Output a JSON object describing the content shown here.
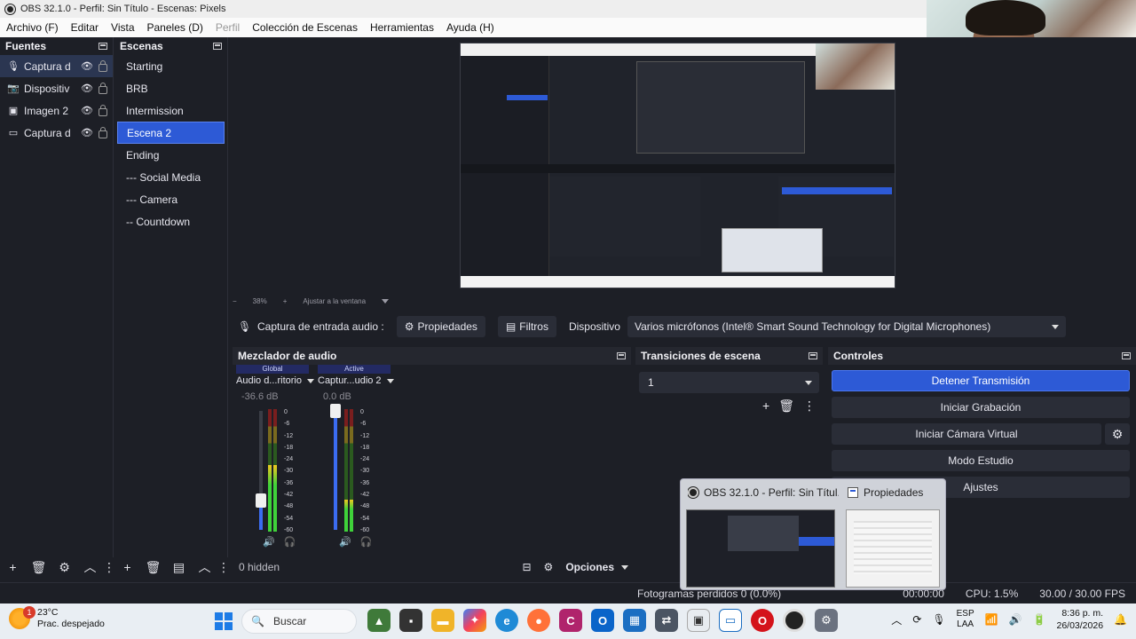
{
  "window": {
    "title": "OBS 32.1.0 - Perfil: Sin Título - Escenas: Pixels"
  },
  "menu": [
    "Archivo (F)",
    "Editar",
    "Vista",
    "Paneles (D)",
    "Perfil",
    "Colección de Escenas",
    "Herramientas",
    "Ayuda (H)"
  ],
  "sources": {
    "title": "Fuentes",
    "items": [
      {
        "name": "Captura d",
        "icon": "microphone-icon"
      },
      {
        "name": "Dispositiv",
        "icon": "camera-icon"
      },
      {
        "name": "Imagen 2",
        "icon": "image-icon"
      },
      {
        "name": "Captura d",
        "icon": "monitor-icon"
      }
    ]
  },
  "scenes": {
    "title": "Escenas",
    "items": [
      "Starting",
      "BRB",
      "Intermission",
      "Escena 2",
      "Ending",
      "--- Social Media",
      "--- Camera",
      "-- Countdown"
    ],
    "selected": "Escena 2"
  },
  "preview": {
    "zoom": "38%",
    "fit_label": "Ajustar a la ventana"
  },
  "context": {
    "source_label": "Captura de entrada audio :",
    "properties": "Propiedades",
    "filters": "Filtros",
    "device_label": "Dispositivo",
    "device_value": "Varios micrófonos (Intel® Smart Sound Technology for Digital Microphones)"
  },
  "mixer": {
    "title": "Mezclador de audio",
    "channels": [
      {
        "tag": "Global",
        "name": "Audio d...ritorio",
        "db": "-36.6 dB",
        "volume": 0.25,
        "level": 0.54
      },
      {
        "tag": "Active",
        "name": "Captur...udio 2",
        "db": "0.0 dB",
        "volume": 1.0,
        "level": 0.26
      }
    ],
    "scale": [
      "0",
      "-6",
      "-12",
      "-18",
      "-24",
      "-30",
      "-36",
      "-42",
      "-48",
      "-54",
      "-60"
    ],
    "hidden": "0 hidden",
    "options": "Opciones"
  },
  "transitions": {
    "title": "Transiciones de escena",
    "value": "1"
  },
  "controls": {
    "title": "Controles",
    "buttons": [
      "Detener Transmisión",
      "Iniciar Grabación",
      "Iniciar Cámara Virtual",
      "Modo Estudio",
      "Ajustes"
    ]
  },
  "status": {
    "frames": "Fotogramas perdidos 0 (0.0%)",
    "time": "00:00:00",
    "cpu": "CPU: 1.5%",
    "fps": "30.00 / 30.00 FPS"
  },
  "thumbs": {
    "obs_title": "OBS 32.1.0 - Perfil: Sin Títul...",
    "props_title": "Propiedades"
  },
  "taskbar": {
    "temp": "23°C",
    "weather": "Prac. despejado",
    "badge": "1",
    "search": "Buscar",
    "lang1": "ESP",
    "lang2": "LAA",
    "time": "8:36 p. m.",
    "date": "26/03/2026"
  }
}
